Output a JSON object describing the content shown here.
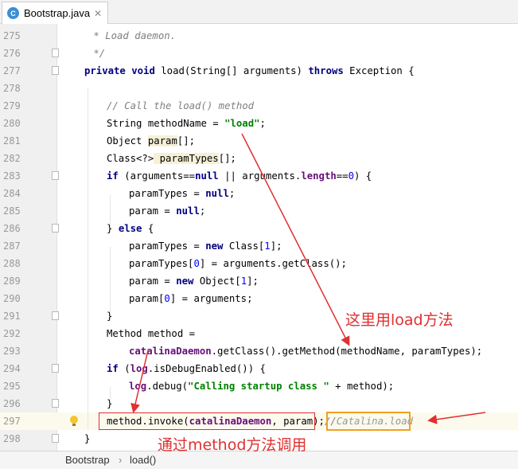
{
  "tab": {
    "icon_letter": "C",
    "title": "Bootstrap.java",
    "close": "✕"
  },
  "colors": {
    "annotation": "#e03030",
    "box_orange": "#f0a020",
    "keyword": "#000080",
    "string": "#008000",
    "field": "#660e7a",
    "comment": "#808080"
  },
  "lines": [
    {
      "n": "275",
      "fold": false
    },
    {
      "n": "276",
      "fold": true
    },
    {
      "n": "277",
      "fold": true
    },
    {
      "n": "278",
      "fold": false
    },
    {
      "n": "279",
      "fold": false
    },
    {
      "n": "280",
      "fold": false
    },
    {
      "n": "281",
      "fold": false
    },
    {
      "n": "282",
      "fold": false
    },
    {
      "n": "283",
      "fold": true
    },
    {
      "n": "284",
      "fold": false
    },
    {
      "n": "285",
      "fold": false
    },
    {
      "n": "286",
      "fold": true
    },
    {
      "n": "287",
      "fold": false
    },
    {
      "n": "288",
      "fold": false
    },
    {
      "n": "289",
      "fold": false
    },
    {
      "n": "290",
      "fold": false
    },
    {
      "n": "291",
      "fold": true
    },
    {
      "n": "292",
      "fold": false
    },
    {
      "n": "293",
      "fold": false
    },
    {
      "n": "294",
      "fold": true
    },
    {
      "n": "295",
      "fold": false
    },
    {
      "n": "296",
      "fold": true
    },
    {
      "n": "297",
      "fold": false
    },
    {
      "n": "298",
      "fold": true
    }
  ],
  "code": {
    "l275": " * Load daemon.",
    "l276": " */",
    "l277a": "private",
    "l277b": "void",
    "l277c": " load(String[] arguments) ",
    "l277d": "throws",
    "l277e": " Exception {",
    "l279": "// Call the load() method",
    "l280a": "String methodName = ",
    "l280b": "\"load\"",
    "l280c": ";",
    "l281a": "Object ",
    "l281b": "param",
    "l281c": "[];",
    "l282a": "Class",
    "l282b": "<?>",
    "l282c": " paramTypes",
    "l282d": "[];",
    "l283a": "if",
    "l283b": " (arguments==",
    "l283c": "null",
    "l283d": " || arguments.",
    "l283e": "length",
    "l283f": "==",
    "l283g": "0",
    "l283h": ") {",
    "l284a": "paramTypes = ",
    "l284b": "null",
    "l284c": ";",
    "l285a": "param = ",
    "l285b": "null",
    "l285c": ";",
    "l286a": "} ",
    "l286b": "else",
    "l286c": " {",
    "l287a": "paramTypes = ",
    "l287b": "new",
    "l287c": " Class[",
    "l287d": "1",
    "l287e": "];",
    "l288a": "paramTypes[",
    "l288b": "0",
    "l288c": "] = arguments.getClass();",
    "l289a": "param = ",
    "l289b": "new",
    "l289c": " Object[",
    "l289d": "1",
    "l289e": "];",
    "l290a": "param[",
    "l290b": "0",
    "l290c": "] = arguments;",
    "l291": "}",
    "l292": "Method method =",
    "l293a": "catalinaDaemon",
    "l293b": ".getClass().getMethod(methodName, paramTypes);",
    "l294a": "if",
    "l294b": " (",
    "l294c": "log",
    "l294d": ".isDebugEnabled()) {",
    "l295a": "log",
    "l295b": ".debug(",
    "l295c": "\"Calling startup class \"",
    "l295d": " + method);",
    "l296": "}",
    "l297a": "method.invoke(",
    "l297b": "catalinaDaemon",
    "l297c": ", param);",
    "l297d": "//",
    "l297e": "Catalina.load",
    "l298": "}"
  },
  "annotations": {
    "load_call": "这里用load方法",
    "method_call": "通过method方法调用"
  },
  "breadcrumb": {
    "class": "Bootstrap",
    "sep": "›",
    "method": "load()"
  }
}
